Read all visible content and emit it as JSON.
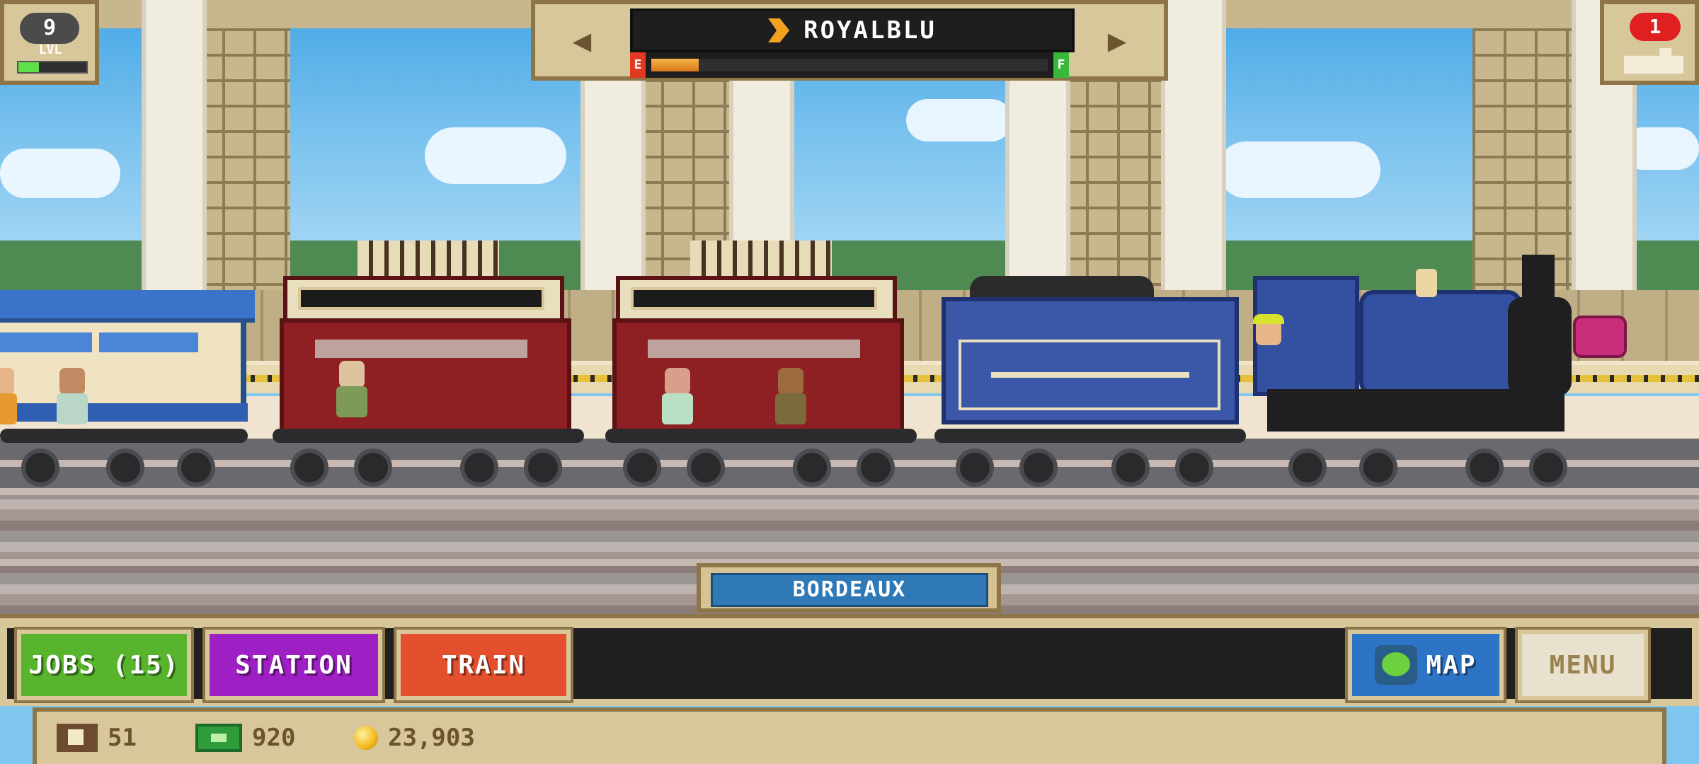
{
  "hud": {
    "level": {
      "value": "9",
      "label": "LVL",
      "progress": 0.3
    },
    "train_name": "ROYALBLU",
    "fuel": {
      "empty_label": "E",
      "full_label": "F",
      "level": 0.12
    },
    "prev_arrow": "◀",
    "next_arrow": "▶",
    "notifications": {
      "count": "1"
    }
  },
  "station": {
    "name": "BORDEAUX"
  },
  "toolbar": {
    "jobs_label": "JOBS (15)",
    "station_label": "STATION",
    "train_label": "TRAIN",
    "map_label": "MAP",
    "menu_label": "MENU"
  },
  "resources": {
    "tickets": "51",
    "cash": "920",
    "coins": "23,903"
  },
  "colors": {
    "jobs": "#58b42c",
    "station": "#9e1fc4",
    "train": "#e4502e",
    "map": "#2d73c6",
    "menu": "#e8e1cd",
    "locomotive": "#3450a0"
  }
}
